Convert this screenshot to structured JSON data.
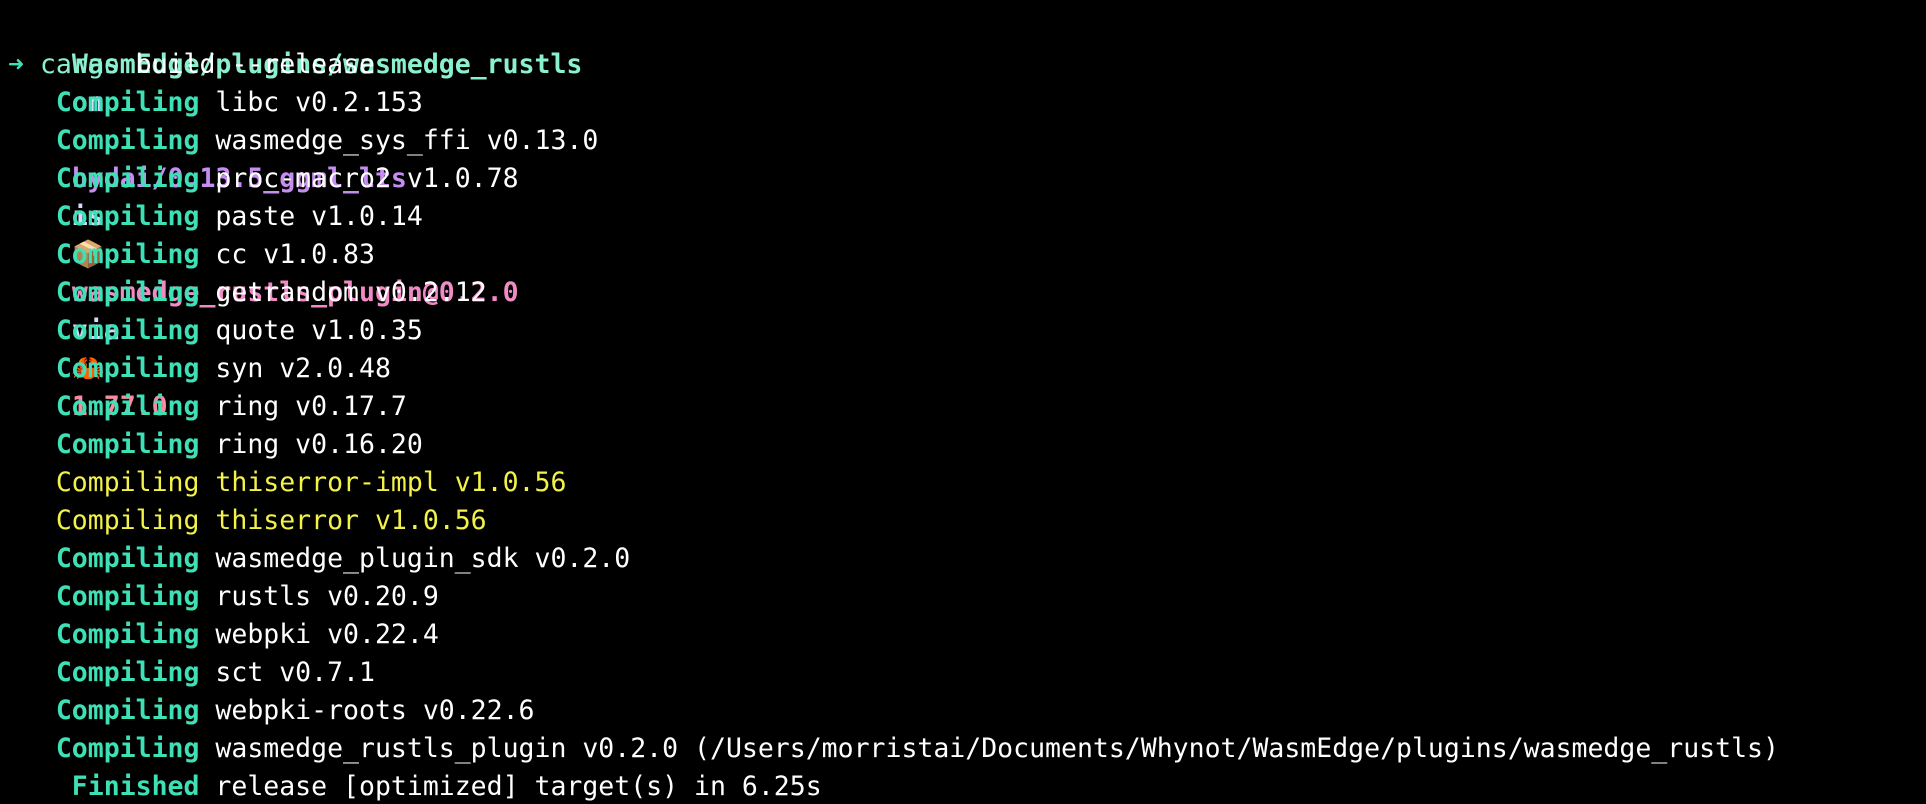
{
  "colors": {
    "background": "#000000",
    "path": "#8af0d0",
    "keyword": "#d7d7ff",
    "branch": "#c78ef2",
    "package": "#f08bc6",
    "rust_version": "#f58ca0",
    "status_green": "#3ee0b6",
    "warning_yellow": "#f2f24a",
    "text": "#ffffff",
    "cargo": "#8af0d0"
  },
  "prompt": {
    "path": "WasmEdge/plugins/wasmedge_rustls",
    "on": "on",
    "branch_icon": "",
    "branch_icon_name": "git-branch-icon",
    "branch": "hydai/0.13.5_ggml_lts",
    "is": "is",
    "package_icon": "📦",
    "package_icon_name": "package-box-icon",
    "package": "wasmedge_rustls_plugin@0.2.0",
    "via": "via",
    "rust_icon": "🦀",
    "rust_icon_name": "crab-icon",
    "rust_version": "1.77.0"
  },
  "command": {
    "arrow": "➜",
    "program": "cargo",
    "args": " build --release"
  },
  "output": [
    {
      "status": "Compiling",
      "text": "libc v0.2.153",
      "style": "normal"
    },
    {
      "status": "Compiling",
      "text": "wasmedge_sys_ffi v0.13.0",
      "style": "normal"
    },
    {
      "status": "Compiling",
      "text": "proc-macro2 v1.0.78",
      "style": "normal"
    },
    {
      "status": "Compiling",
      "text": "paste v1.0.14",
      "style": "normal"
    },
    {
      "status": "Compiling",
      "text": "cc v1.0.83",
      "style": "normal"
    },
    {
      "status": "Compiling",
      "text": "getrandom v0.2.12",
      "style": "normal"
    },
    {
      "status": "Compiling",
      "text": "quote v1.0.35",
      "style": "normal"
    },
    {
      "status": "Compiling",
      "text": "syn v2.0.48",
      "style": "normal"
    },
    {
      "status": "Compiling",
      "text": "ring v0.17.7",
      "style": "normal"
    },
    {
      "status": "Compiling",
      "text": "ring v0.16.20",
      "style": "normal"
    },
    {
      "status": "Compiling",
      "text": "thiserror-impl v1.0.56",
      "style": "highlight"
    },
    {
      "status": "Compiling",
      "text": "thiserror v1.0.56",
      "style": "highlight"
    },
    {
      "status": "Compiling",
      "text": "wasmedge_plugin_sdk v0.2.0",
      "style": "normal"
    },
    {
      "status": "Compiling",
      "text": "rustls v0.20.9",
      "style": "normal"
    },
    {
      "status": "Compiling",
      "text": "webpki v0.22.4",
      "style": "normal"
    },
    {
      "status": "Compiling",
      "text": "sct v0.7.1",
      "style": "normal"
    },
    {
      "status": "Compiling",
      "text": "webpki-roots v0.22.6",
      "style": "normal"
    },
    {
      "status": "Compiling",
      "text": "wasmedge_rustls_plugin v0.2.0 (/Users/morristai/Documents/Whynot/WasmEdge/plugins/wasmedge_rustls)",
      "style": "normal"
    },
    {
      "status": "Finished",
      "text": "release [optimized] target(s) in 6.25s",
      "style": "normal"
    }
  ]
}
